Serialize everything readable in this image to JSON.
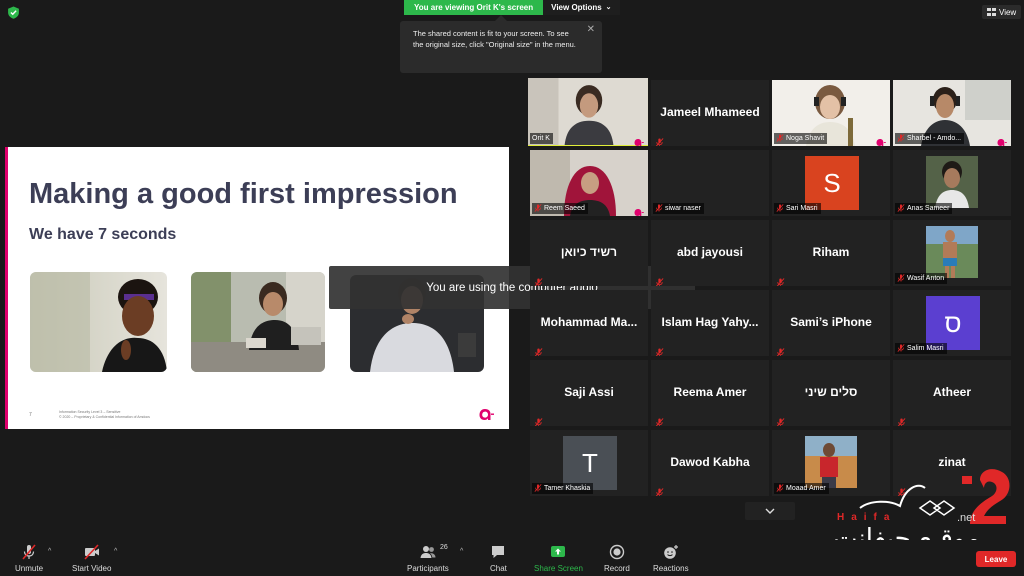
{
  "header": {
    "banner_text": "You are viewing Orit K's screen",
    "view_options_label": "View Options",
    "view_label": "View",
    "tooltip_text": "The shared content is fit to your screen. To see the original size, click \"Original size\" in the menu."
  },
  "slide": {
    "title": "Making a good first impression",
    "subtitle": "We have 7 seconds",
    "page_number": "7",
    "footer_line1": "Information Security Level 3 – Sensitive",
    "footer_line2": "© 2020 – Proprietary & Confidential Information of Amdocs"
  },
  "toast": "You are using the computer audio",
  "participants_grid": [
    {
      "name": "Orit K",
      "type": "video",
      "active": true,
      "muted": false
    },
    {
      "name": "Jameel Mhameed",
      "type": "name",
      "muted": true
    },
    {
      "name": "Noga Shavit",
      "type": "video",
      "muted": true
    },
    {
      "name": "Sharbel - Amdo...",
      "type": "video",
      "muted": true
    },
    {
      "name": "Reem Saeed",
      "type": "video",
      "muted": true
    },
    {
      "name": "siwar naser",
      "type": "blank",
      "muted": true
    },
    {
      "name": "Sari Masri",
      "type": "avatar",
      "initial": "S",
      "color": "#d9431f",
      "muted": true
    },
    {
      "name": "Anas Sameer",
      "type": "photo",
      "muted": true
    },
    {
      "name": "רשיד כיואן",
      "type": "name",
      "muted": true
    },
    {
      "name": "abd jayousi",
      "type": "name",
      "muted": true
    },
    {
      "name": "Riham",
      "type": "name",
      "muted": true
    },
    {
      "name": "Wasif Anton",
      "type": "photo",
      "muted": true
    },
    {
      "name": "Mohammad  Ma...",
      "type": "name",
      "muted": true
    },
    {
      "name": "Islam  Hag  Yahy...",
      "type": "name",
      "muted": true
    },
    {
      "name": "Sami’s iPhone",
      "type": "name",
      "muted": true
    },
    {
      "name": "Salim Masri",
      "type": "avatar",
      "initial": "ס",
      "color": "#5b3fd0",
      "muted": true
    },
    {
      "name": "Saji Assi",
      "type": "name",
      "muted": true
    },
    {
      "name": "Reema Amer",
      "type": "name",
      "muted": true
    },
    {
      "name": "סלים שיני",
      "type": "name",
      "muted": true
    },
    {
      "name": "Atheer",
      "type": "name",
      "muted": true
    },
    {
      "name": "Tamer Khaskia",
      "type": "avatar",
      "initial": "T",
      "color": "#4a4f55",
      "muted": true
    },
    {
      "name": "Dawod Kabha",
      "type": "name",
      "muted": true
    },
    {
      "name": "Moaad Amer",
      "type": "photo",
      "muted": true
    },
    {
      "name": "zinat",
      "type": "name",
      "muted": true
    }
  ],
  "toolbar": {
    "unmute": "Unmute",
    "start_video": "Start Video",
    "participants": "Participants",
    "participants_count": "26",
    "chat": "Chat",
    "share_screen": "Share Screen",
    "record": "Record",
    "reactions": "Reactions",
    "leave": "Leave"
  },
  "watermark": {
    "latin": "Haifa",
    "net": ".net",
    "arabic": "موقـع حيفانت"
  },
  "colors": {
    "share_green": "#2db84b",
    "active_border": "#e2ef3a",
    "muted_red": "#e02828",
    "slide_accent": "#e0006d",
    "title_navy": "#3c3e56"
  }
}
